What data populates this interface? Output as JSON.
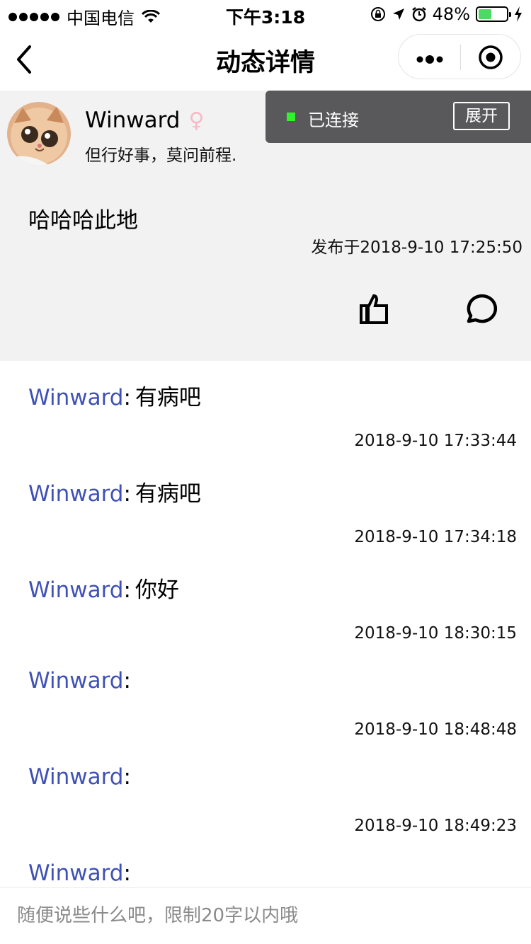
{
  "status_bar": {
    "carrier": "中国电信",
    "time": "下午3:18",
    "battery": "48%",
    "battery_level": 0.48,
    "icons": [
      "wifi-icon",
      "rotation-lock-icon",
      "location-icon",
      "alarm-icon",
      "charging-icon"
    ]
  },
  "nav": {
    "title": "动态详情",
    "back_icon": "chevron-left-icon",
    "more_icon": "more-dots-icon",
    "close_icon": "target-close-icon"
  },
  "post": {
    "username": "Winward",
    "gender": "♀",
    "bio": "但行好事，莫问前程.",
    "content": "哈哈哈此地",
    "published": "发布于2018-9-10 17:25:50",
    "like_icon": "thumbs-up-icon",
    "comment_icon": "comment-bubble-icon"
  },
  "toast": {
    "status": "已连接",
    "expand": "展开",
    "status_color": "#2ef32e"
  },
  "comments": [
    {
      "user": "Winward",
      "colon": ":",
      "text": "有病吧",
      "time": "2018-9-10 17:33:44"
    },
    {
      "user": "Winward",
      "colon": ":",
      "text": "有病吧",
      "time": "2018-9-10 17:34:18"
    },
    {
      "user": "Winward",
      "colon": ":",
      "text": "你好",
      "time": "2018-9-10 18:30:15"
    },
    {
      "user": "Winward",
      "colon": ":",
      "text": "",
      "time": "2018-9-10 18:48:48"
    },
    {
      "user": "Winward",
      "colon": ":",
      "text": "",
      "time": "2018-9-10 18:49:23"
    },
    {
      "user": "Winward",
      "colon": ":",
      "text": "",
      "time": ""
    }
  ],
  "input": {
    "placeholder": "随便说些什么吧，限制20字以内哦"
  },
  "colors": {
    "username": "#3f51b5",
    "post_bg": "#f2f2f2",
    "toast_bg": "#59595b",
    "gender": "#f8b9c6"
  }
}
